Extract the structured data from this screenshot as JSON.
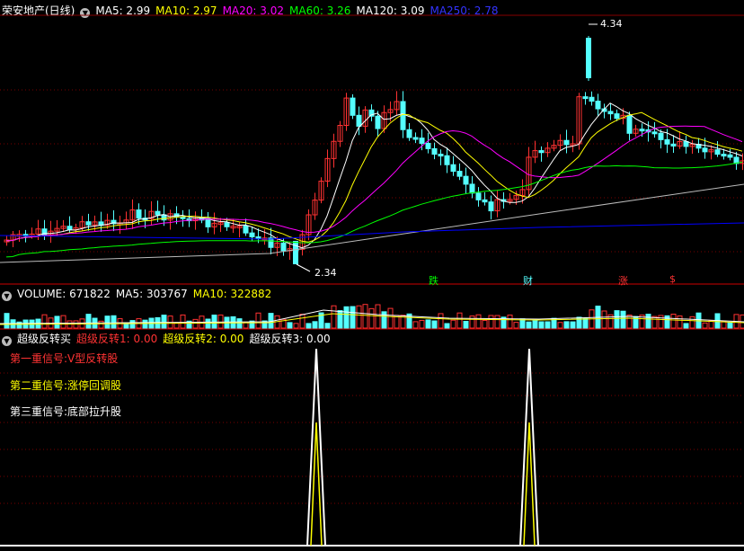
{
  "main": {
    "stock_name": "荣安地产(日线)",
    "ma": [
      {
        "label": "MA5: 2.99",
        "color": "#ffffff"
      },
      {
        "label": "MA10: 2.97",
        "color": "#ffff00"
      },
      {
        "label": "MA20: 3.02",
        "color": "#ff00ff"
      },
      {
        "label": "MA60: 3.26",
        "color": "#00ff00"
      },
      {
        "label": "MA120: 3.09",
        "color": "#ffffff"
      },
      {
        "label": "MA250: 2.78",
        "color": "#0000ff"
      }
    ],
    "high_label": "4.34",
    "low_label": "2.34",
    "tags": [
      "跌",
      "财",
      "涨",
      "$"
    ]
  },
  "volume": {
    "title": "VOLUME: 671822",
    "ma5": "MA5: 303767",
    "ma10": "MA10: 322882"
  },
  "indicator": {
    "title": "超级反转买",
    "s1": "超级反转1: 0.00",
    "s2": "超级反转2: 0.00",
    "s3": "超级反转3: 0.00",
    "signals": [
      {
        "label": "第一重信号:",
        "value": "V型反转股"
      },
      {
        "label": "第二重信号:",
        "value": "涨停回调股"
      },
      {
        "label": "第三重信号:",
        "value": "底部拉升股"
      }
    ]
  },
  "colors": {
    "up": "#ff3232",
    "down": "#54ffff",
    "bg": "#000000"
  }
}
